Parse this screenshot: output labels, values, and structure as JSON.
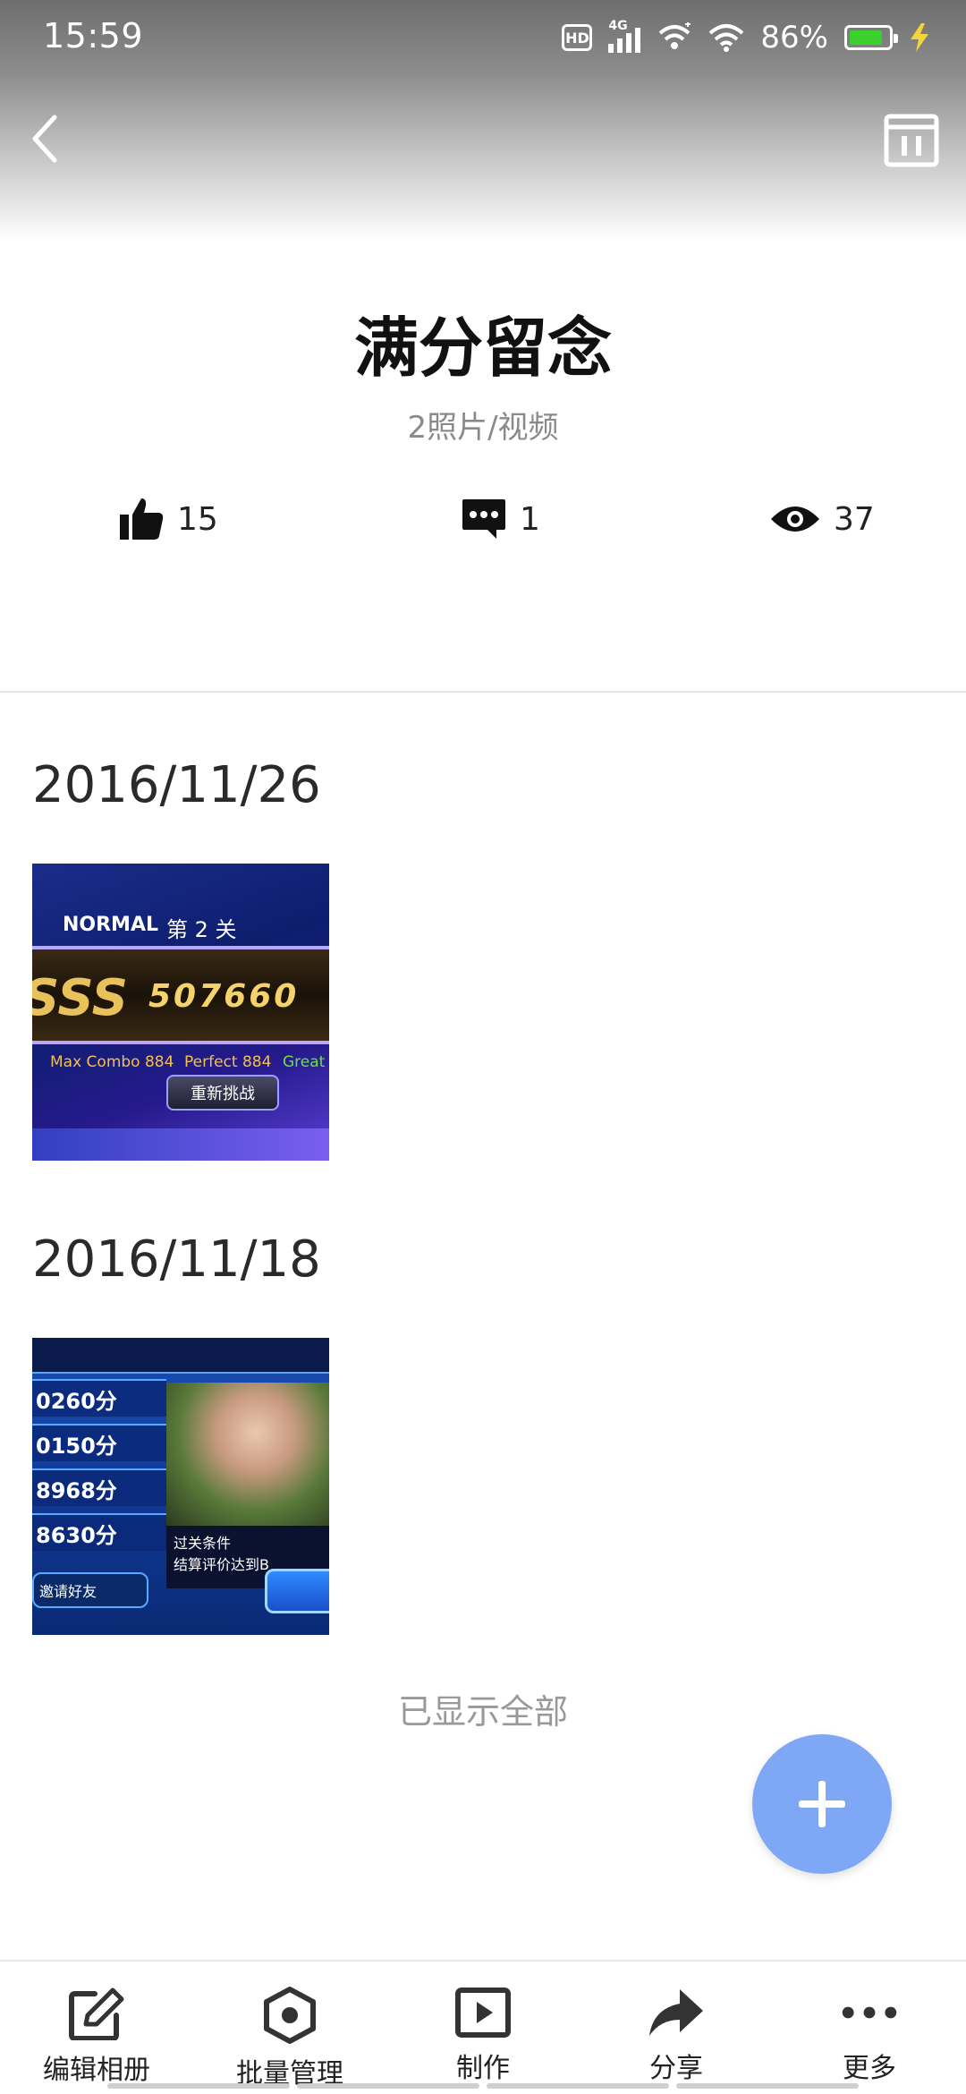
{
  "status_bar": {
    "time": "15:59",
    "hd": "HD",
    "network": "4G",
    "battery_percent": "86%",
    "battery_level": 0.86,
    "icons": [
      "hd-icon",
      "signal-4g-icon",
      "wifi-alt-icon",
      "wifi-icon",
      "battery-icon",
      "charging-bolt-icon"
    ]
  },
  "nav": {
    "back_icon": "chevron-left-icon",
    "calendar_icon": "calendar-icon"
  },
  "album": {
    "title": "满分留念",
    "subtitle": "2照片/视频"
  },
  "stats": {
    "likes": "15",
    "comments": "1",
    "views": "37"
  },
  "groups": [
    {
      "date": "2016/11/26",
      "thumb": {
        "mode": "NORMAL",
        "stage": "第 2 关",
        "score": "507660",
        "grade": "SSS",
        "max_combo": "Max Combo 884",
        "perfect": "Perfect 884",
        "great": "Great",
        "retry": "重新挑战"
      }
    },
    {
      "date": "2016/11/18",
      "thumb": {
        "scores": [
          "0260分",
          "0150分",
          "8968分",
          "8630分"
        ],
        "caption_1": "过关条件",
        "caption_2": "结算评价达到B",
        "invite": "邀请好友"
      }
    }
  ],
  "end_note": "已显示全部",
  "fab": {
    "icon": "plus-icon"
  },
  "toolbar": {
    "items": [
      {
        "label": "编辑相册",
        "icon": "edit-icon"
      },
      {
        "label": "批量管理",
        "icon": "manage-icon"
      },
      {
        "label": "制作",
        "icon": "play-box-icon"
      },
      {
        "label": "分享",
        "icon": "share-icon"
      },
      {
        "label": "更多",
        "icon": "more-icon"
      }
    ]
  },
  "colors": {
    "accent": "#7ea7f5",
    "battery_green": "#3ad12e",
    "muted_text": "#8a8a8a"
  }
}
